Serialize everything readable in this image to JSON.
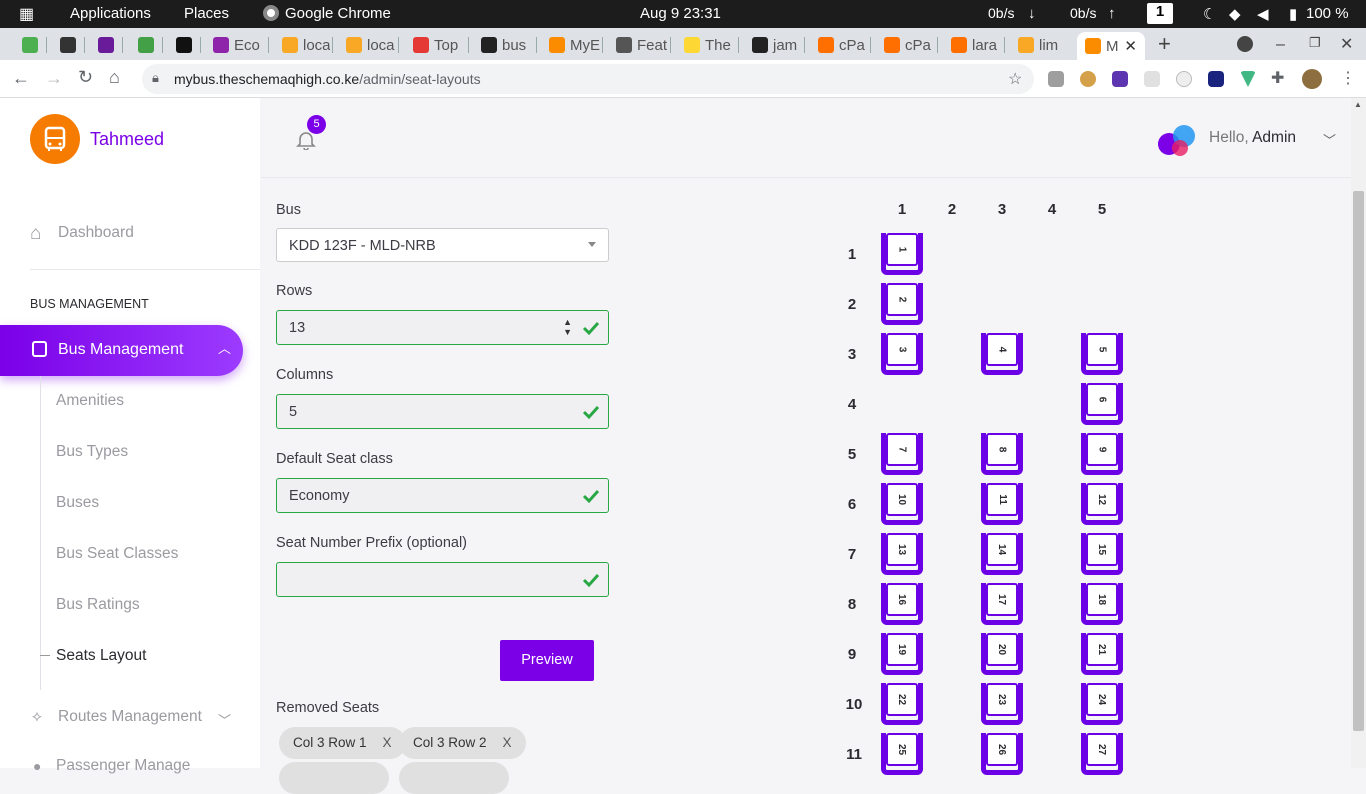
{
  "os_bar": {
    "activities": "Applications",
    "places": "Places",
    "app": "Google Chrome",
    "datetime": "Aug 9  23:31",
    "net_down": "0b/s",
    "net_up": "0b/s",
    "workspace": "1",
    "battery": "100 %"
  },
  "tabs": [
    {
      "label": "",
      "color": "#4caf50"
    },
    {
      "label": "",
      "color": "#333"
    },
    {
      "label": "",
      "color": "#6a1b9a"
    },
    {
      "label": "",
      "color": "#43a047"
    },
    {
      "label": "",
      "color": "#111"
    },
    {
      "label": "Eco",
      "color": "#8e24aa"
    },
    {
      "label": "loca",
      "color": "#f9a825"
    },
    {
      "label": "loca",
      "color": "#f9a825"
    },
    {
      "label": "Top",
      "color": "#e53935"
    },
    {
      "label": "bus",
      "color": "#222"
    },
    {
      "label": "MyE",
      "color": "#fb8c00"
    },
    {
      "label": "Feat",
      "color": "#555"
    },
    {
      "label": "The",
      "color": "#fdd835"
    },
    {
      "label": "jam",
      "color": "#222"
    },
    {
      "label": "cPa",
      "color": "#ff6f00"
    },
    {
      "label": "cPa",
      "color": "#ff6f00"
    },
    {
      "label": "lara",
      "color": "#ff6f00"
    },
    {
      "label": "lim",
      "color": "#f9a825"
    },
    {
      "label": "M",
      "color": "#fb8c00"
    }
  ],
  "address": {
    "host": "mybus.theschemaqhigh.co.ke",
    "path": "/admin/seat-layouts"
  },
  "sidebar": {
    "brand": "Tahmeed",
    "dashboard": "Dashboard",
    "section": "BUS MANAGEMENT",
    "active": "Bus Management",
    "items": [
      "Amenities",
      "Bus Types",
      "Buses",
      "Bus Seat Classes",
      "Bus Ratings",
      "Seats Layout"
    ],
    "routes": "Routes Management",
    "passenger": "Passenger Manage"
  },
  "header": {
    "notifications": "5",
    "greeting": "Hello,",
    "user": "Admin"
  },
  "form": {
    "bus_label": "Bus",
    "bus_value": "KDD 123F - MLD-NRB",
    "rows_label": "Rows",
    "rows_value": "13",
    "columns_label": "Columns",
    "columns_value": "5",
    "class_label": "Default Seat class",
    "class_value": "Economy",
    "prefix_label": "Seat Number Prefix (optional)",
    "prefix_value": "",
    "preview": "Preview",
    "removed_label": "Removed Seats",
    "removed": [
      "Col 3 Row 1",
      "Col 3 Row 2"
    ],
    "remove_x": "X"
  },
  "layout": {
    "columns": [
      "1",
      "2",
      "3",
      "4",
      "5"
    ],
    "rows": [
      "1",
      "2",
      "3",
      "4",
      "5",
      "6",
      "7",
      "8",
      "9",
      "10",
      "11"
    ],
    "seats": [
      {
        "n": "1",
        "row": 1,
        "col": 1
      },
      {
        "n": "2",
        "row": 2,
        "col": 1
      },
      {
        "n": "3",
        "row": 3,
        "col": 1
      },
      {
        "n": "4",
        "row": 3,
        "col": 3
      },
      {
        "n": "5",
        "row": 3,
        "col": 5
      },
      {
        "n": "6",
        "row": 4,
        "col": 5
      },
      {
        "n": "7",
        "row": 5,
        "col": 1
      },
      {
        "n": "8",
        "row": 5,
        "col": 3
      },
      {
        "n": "9",
        "row": 5,
        "col": 5
      },
      {
        "n": "10",
        "row": 6,
        "col": 1
      },
      {
        "n": "11",
        "row": 6,
        "col": 3
      },
      {
        "n": "12",
        "row": 6,
        "col": 5
      },
      {
        "n": "13",
        "row": 7,
        "col": 1
      },
      {
        "n": "14",
        "row": 7,
        "col": 3
      },
      {
        "n": "15",
        "row": 7,
        "col": 5
      },
      {
        "n": "16",
        "row": 8,
        "col": 1
      },
      {
        "n": "17",
        "row": 8,
        "col": 3
      },
      {
        "n": "18",
        "row": 8,
        "col": 5
      },
      {
        "n": "19",
        "row": 9,
        "col": 1
      },
      {
        "n": "20",
        "row": 9,
        "col": 3
      },
      {
        "n": "21",
        "row": 9,
        "col": 5
      },
      {
        "n": "22",
        "row": 10,
        "col": 1
      },
      {
        "n": "23",
        "row": 10,
        "col": 3
      },
      {
        "n": "24",
        "row": 10,
        "col": 5
      },
      {
        "n": "25",
        "row": 11,
        "col": 1
      },
      {
        "n": "26",
        "row": 11,
        "col": 3
      },
      {
        "n": "27",
        "row": 11,
        "col": 5
      }
    ]
  },
  "colors": {
    "accent": "#7b00e8",
    "valid": "#28a745",
    "brand_logo": "#f57c00"
  }
}
